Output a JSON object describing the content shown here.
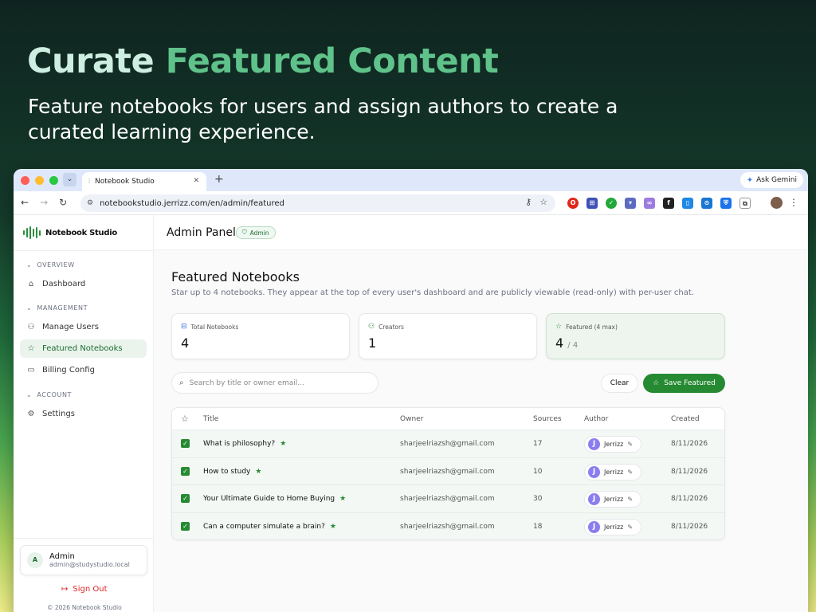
{
  "hero": {
    "title_part1": "Curate",
    "title_part2": "Featured Content",
    "subtitle": "Feature notebooks for users and assign authors to create a curated learning experience."
  },
  "browser": {
    "tab_title": "Notebook Studio",
    "url": "notebookstudio.jerrizz.com/en/admin/featured",
    "ask_gemini": "Ask Gemini"
  },
  "sidebar": {
    "brand": "Notebook Studio",
    "sections": [
      {
        "label": "OVERVIEW",
        "items": [
          {
            "label": "Dashboard",
            "icon": "home-icon",
            "active": false
          }
        ]
      },
      {
        "label": "MANAGEMENT",
        "items": [
          {
            "label": "Manage Users",
            "icon": "users-icon",
            "active": false
          },
          {
            "label": "Featured Notebooks",
            "icon": "star-icon",
            "active": true
          },
          {
            "label": "Billing Config",
            "icon": "card-icon",
            "active": false
          }
        ]
      },
      {
        "label": "ACCOUNT",
        "items": [
          {
            "label": "Settings",
            "icon": "gear-icon",
            "active": false
          }
        ]
      }
    ],
    "user": {
      "initial": "A",
      "name": "Admin",
      "email": "admin@studystudio.local"
    },
    "signout": "Sign Out",
    "copyright": "© 2026 Notebook Studio"
  },
  "topbar": {
    "title": "Admin Panel",
    "badge": "Admin"
  },
  "page": {
    "title": "Featured Notebooks",
    "subtitle": "Star up to 4 notebooks. They appear at the top of every user's dashboard and are publicly viewable (read-only) with per-user chat."
  },
  "stats": [
    {
      "label": "Total Notebooks",
      "value": "4",
      "icon": "book-icon"
    },
    {
      "label": "Creators",
      "value": "1",
      "icon": "users-icon"
    },
    {
      "label": "Featured (4 max)",
      "value": "4",
      "suffix": "/ 4",
      "icon": "star-icon"
    }
  ],
  "toolbar": {
    "search_placeholder": "Search by title or owner email...",
    "clear_label": "Clear",
    "save_label": "Save Featured"
  },
  "table": {
    "headers": {
      "title": "Title",
      "owner": "Owner",
      "sources": "Sources",
      "author": "Author",
      "created": "Created"
    },
    "rows": [
      {
        "title": "What is philosophy?",
        "owner": "sharjeelriazsh@gmail.com",
        "sources": "17",
        "author": "Jerrizz",
        "author_initial": "J",
        "created": "8/11/2026"
      },
      {
        "title": "How to study",
        "owner": "sharjeelriazsh@gmail.com",
        "sources": "10",
        "author": "Jerrizz",
        "author_initial": "J",
        "created": "8/11/2026"
      },
      {
        "title": "Your Ultimate Guide to Home Buying",
        "owner": "sharjeelriazsh@gmail.com",
        "sources": "30",
        "author": "Jerrizz",
        "author_initial": "J",
        "created": "8/11/2026"
      },
      {
        "title": "Can a computer simulate a brain?",
        "owner": "sharjeelriazsh@gmail.com",
        "sources": "18",
        "author": "Jerrizz",
        "author_initial": "J",
        "created": "8/11/2026"
      }
    ]
  },
  "colors": {
    "accent": "#268a33",
    "active_bg": "#eaf4ec",
    "signout": "#dc2626"
  }
}
